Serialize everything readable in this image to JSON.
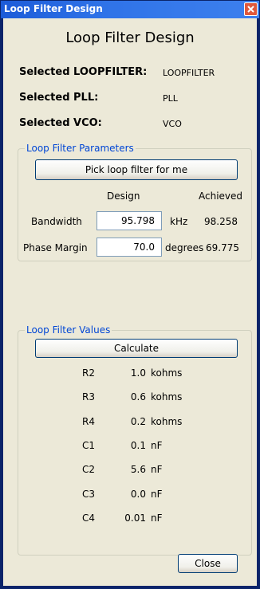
{
  "window": {
    "title": "Loop Filter Design"
  },
  "heading": "Loop Filter Design",
  "selection": [
    {
      "label": "Selected LOOPFILTER:",
      "value": "LOOPFILTER"
    },
    {
      "label": "Selected PLL:",
      "value": "PLL"
    },
    {
      "label": "Selected VCO:",
      "value": "VCO"
    }
  ],
  "parameters": {
    "legend": "Loop Filter Parameters",
    "pick_button": "Pick loop filter for me",
    "col_design": "Design",
    "col_achieved": "Achieved",
    "rows": [
      {
        "label": "Bandwidth",
        "design": "95.798",
        "unit": "kHz",
        "achieved": "98.258"
      },
      {
        "label": "Phase Margin",
        "design": "70.0",
        "unit": "degrees",
        "achieved": "69.775"
      }
    ]
  },
  "values": {
    "legend": "Loop Filter Values",
    "calculate_button": "Calculate",
    "rows": [
      {
        "name": "R2",
        "value": "1.0",
        "unit": "kohms"
      },
      {
        "name": "R3",
        "value": "0.6",
        "unit": "kohms"
      },
      {
        "name": "R4",
        "value": "0.2",
        "unit": "kohms"
      },
      {
        "name": "C1",
        "value": "0.1",
        "unit": "nF"
      },
      {
        "name": "C2",
        "value": "5.6",
        "unit": "nF"
      },
      {
        "name": "C3",
        "value": "0.0",
        "unit": "nF"
      },
      {
        "name": "C4",
        "value": "0.01",
        "unit": "nF"
      }
    ]
  },
  "close_button": "Close",
  "icons": {
    "close": "close-icon"
  },
  "colors": {
    "titlebar": "#2f73e8",
    "group_legend": "#0046d5",
    "dialog_bg": "#ece9d8"
  }
}
